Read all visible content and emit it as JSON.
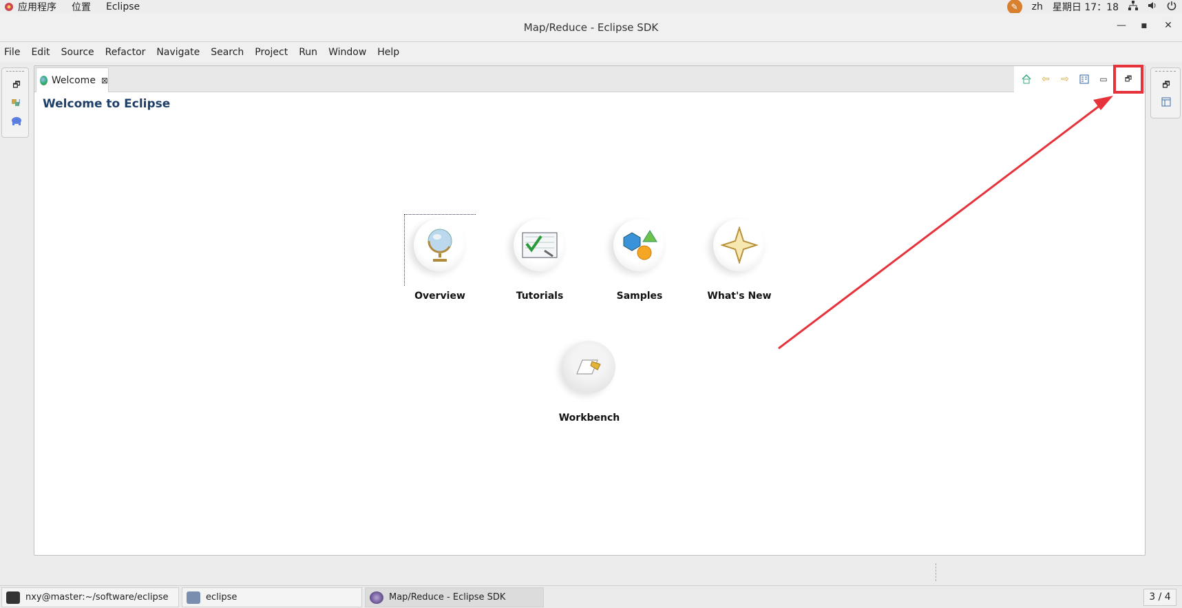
{
  "topbar": {
    "applications": "应用程序",
    "places": "位置",
    "app_name": "Eclipse",
    "input_method": "zh",
    "clock": "星期日 17：18"
  },
  "window": {
    "title": "Map/Reduce - Eclipse SDK"
  },
  "menu": [
    "File",
    "Edit",
    "Source",
    "Refactor",
    "Navigate",
    "Search",
    "Project",
    "Run",
    "Window",
    "Help"
  ],
  "editor": {
    "tab_label": "Welcome",
    "welcome_title": "Welcome to Eclipse",
    "launchers": [
      {
        "label": "Overview",
        "icon": "globe-icon"
      },
      {
        "label": "Tutorials",
        "icon": "checklist-icon"
      },
      {
        "label": "Samples",
        "icon": "shapes-icon"
      },
      {
        "label": "What's New",
        "icon": "star-icon"
      },
      {
        "label": "Workbench",
        "icon": "workbench-icon"
      }
    ]
  },
  "taskbar": {
    "items": [
      {
        "label": "nxy@master:~/software/eclipse",
        "icon": "terminal-icon"
      },
      {
        "label": "eclipse",
        "icon": "file-manager-icon"
      },
      {
        "label": "Map/Reduce - Eclipse SDK",
        "icon": "eclipse-icon"
      }
    ],
    "workspace": "3 / 4"
  },
  "colors": {
    "annotation": "#e6323a",
    "welcome_title": "#1f3f6b"
  }
}
